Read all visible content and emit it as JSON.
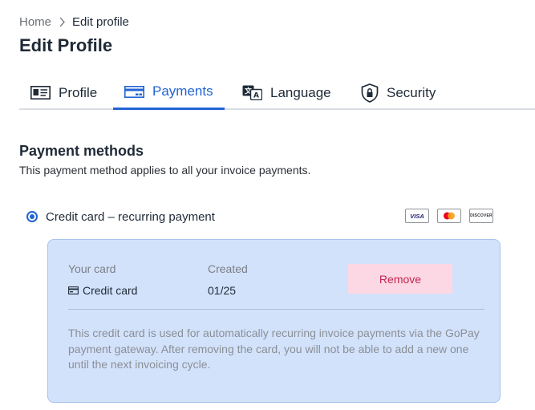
{
  "breadcrumb": {
    "home": "Home",
    "current": "Edit profile"
  },
  "page_title": "Edit Profile",
  "tabs": [
    {
      "label": "Profile",
      "icon": "id-card-icon",
      "active": false
    },
    {
      "label": "Payments",
      "icon": "credit-card-icon",
      "active": true
    },
    {
      "label": "Language",
      "icon": "translate-icon",
      "active": false
    },
    {
      "label": "Security",
      "icon": "shield-lock-icon",
      "active": false
    }
  ],
  "payment_methods": {
    "title": "Payment methods",
    "description": "This payment method applies to all your invoice payments.",
    "method": {
      "label": "Credit card – recurring payment",
      "selected": true,
      "logos": [
        "VISA",
        "mastercard",
        "DISCOVER"
      ]
    },
    "card": {
      "your_card_header": "Your card",
      "created_header": "Created",
      "card_type": "Credit card",
      "created_value": "01/25",
      "remove_label": "Remove",
      "notice": "This credit card is used for automatically recurring invoice payments via the GoPay payment gateway. After removing the card, you will not be able to add a new one until the next invoicing cycle."
    }
  },
  "colors": {
    "accent": "#2164d4",
    "panel_bg": "#d3e2fb",
    "remove_bg": "#fbd8e3",
    "remove_text": "#c22553"
  }
}
